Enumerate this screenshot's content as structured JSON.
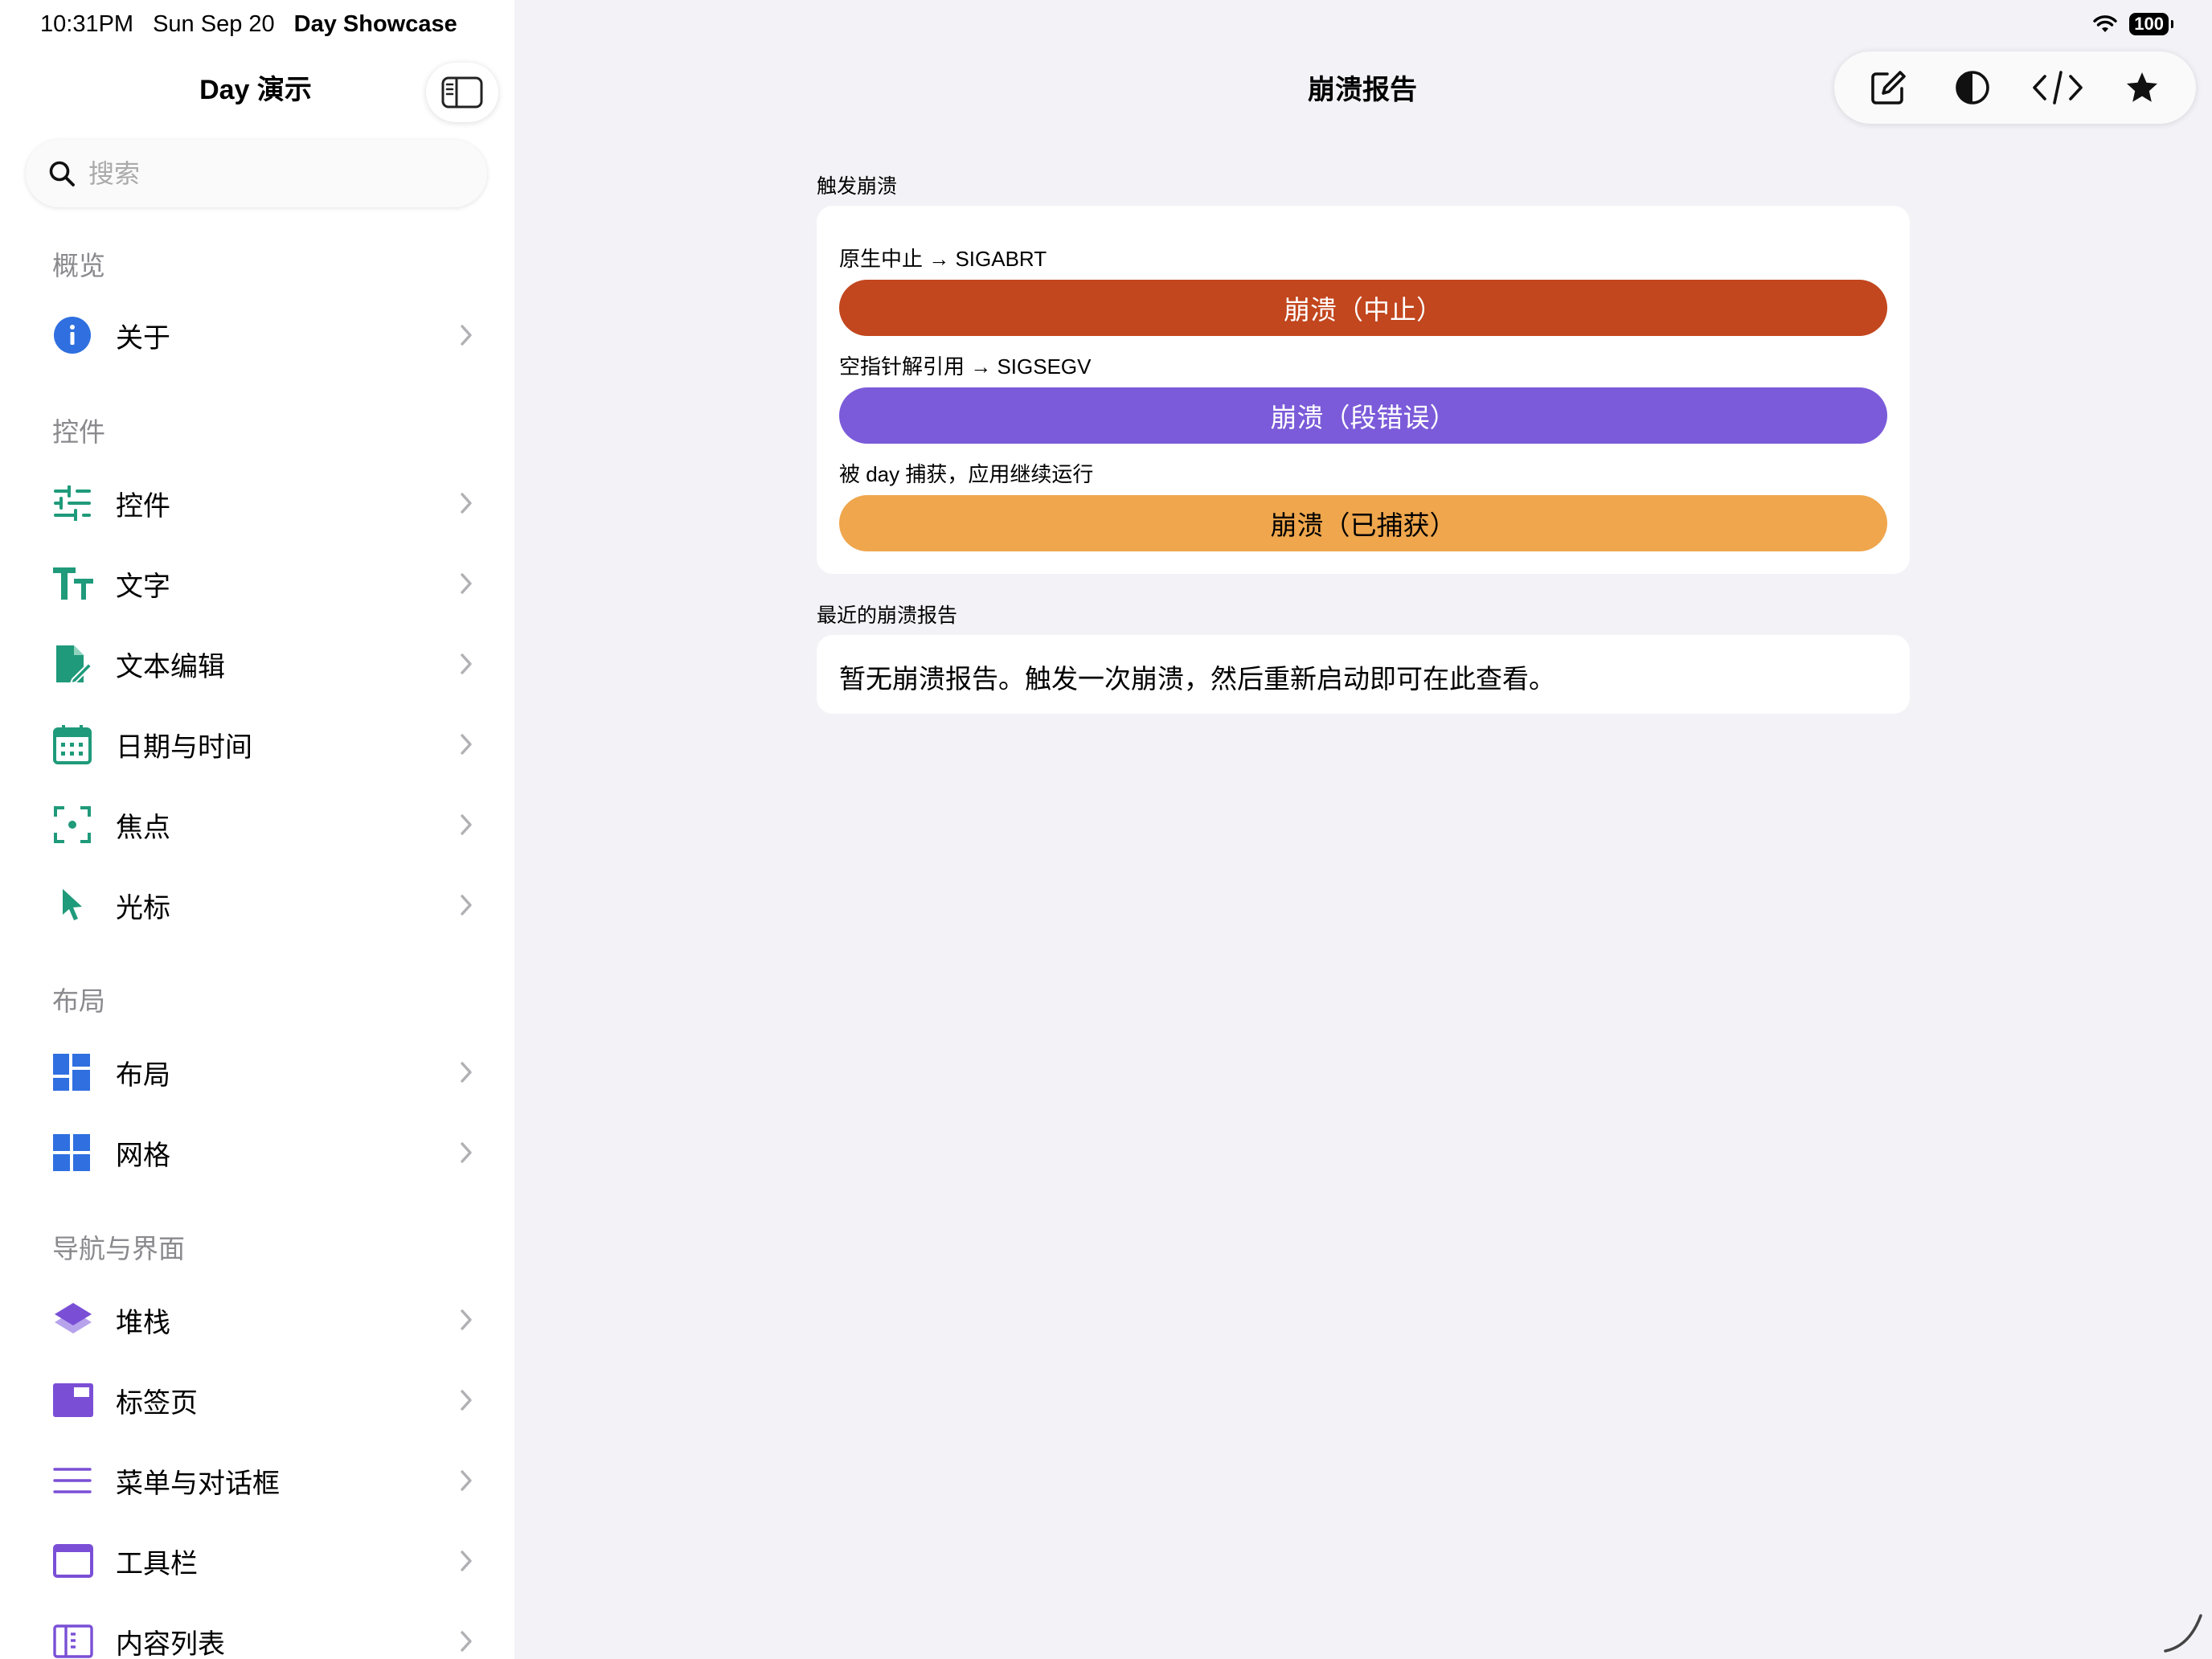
{
  "status_bar": {
    "time": "10:31PM",
    "date": "Sun Sep 20",
    "app_name": "Day Showcase",
    "battery": "100"
  },
  "sidebar": {
    "title": "Day 演示",
    "search_placeholder": "搜索",
    "sections": [
      {
        "header": "概览",
        "items": [
          {
            "label": "关于",
            "icon": "info-icon",
            "color": "#2f6fe0"
          }
        ]
      },
      {
        "header": "控件",
        "items": [
          {
            "label": "控件",
            "icon": "sliders-icon",
            "color": "#1f9a7a"
          },
          {
            "label": "文字",
            "icon": "text-size-icon",
            "color": "#1f9a7a"
          },
          {
            "label": "文本编辑",
            "icon": "document-edit-icon",
            "color": "#1f9a7a"
          },
          {
            "label": "日期与时间",
            "icon": "calendar-icon",
            "color": "#1f9a7a"
          },
          {
            "label": "焦点",
            "icon": "focus-icon",
            "color": "#1f9a7a"
          },
          {
            "label": "光标",
            "icon": "cursor-icon",
            "color": "#1f9a7a"
          }
        ]
      },
      {
        "header": "布局",
        "items": [
          {
            "label": "布局",
            "icon": "layout-icon",
            "color": "#2f6fe0"
          },
          {
            "label": "网格",
            "icon": "grid-icon",
            "color": "#2f6fe0"
          }
        ]
      },
      {
        "header": "导航与界面",
        "items": [
          {
            "label": "堆栈",
            "icon": "stack-icon",
            "color": "#7a4fd6"
          },
          {
            "label": "标签页",
            "icon": "tabs-icon",
            "color": "#7a4fd6"
          },
          {
            "label": "菜单与对话框",
            "icon": "menu-lines-icon",
            "color": "#7a4fd6"
          },
          {
            "label": "工具栏",
            "icon": "window-icon",
            "color": "#7a4fd6"
          },
          {
            "label": "内容列表",
            "icon": "split-view-icon",
            "color": "#7a4fd6"
          }
        ]
      }
    ]
  },
  "nav": {
    "title": "崩溃报告",
    "toolbar_icons": [
      "compose-icon",
      "contrast-icon",
      "code-icon",
      "star-icon"
    ]
  },
  "main": {
    "trigger_section": {
      "label": "触发崩溃",
      "items": [
        {
          "caption": "原生中止 → SIGABRT",
          "button": "崩溃（中止）",
          "color": "#c2461e",
          "text_color": "#ffffff"
        },
        {
          "caption": "空指针解引用 → SIGSEGV",
          "button": "崩溃（段错误）",
          "color": "#7b5bd9",
          "text_color": "#ffffff"
        },
        {
          "caption": "被 day 捕获，应用继续运行",
          "button": "崩溃（已捕获）",
          "color": "#efa64d",
          "text_color": "#000000"
        }
      ]
    },
    "reports_section": {
      "label": "最近的崩溃报告",
      "empty_text": "暂无崩溃报告。触发一次崩溃，然后重新启动即可在此查看。"
    }
  }
}
